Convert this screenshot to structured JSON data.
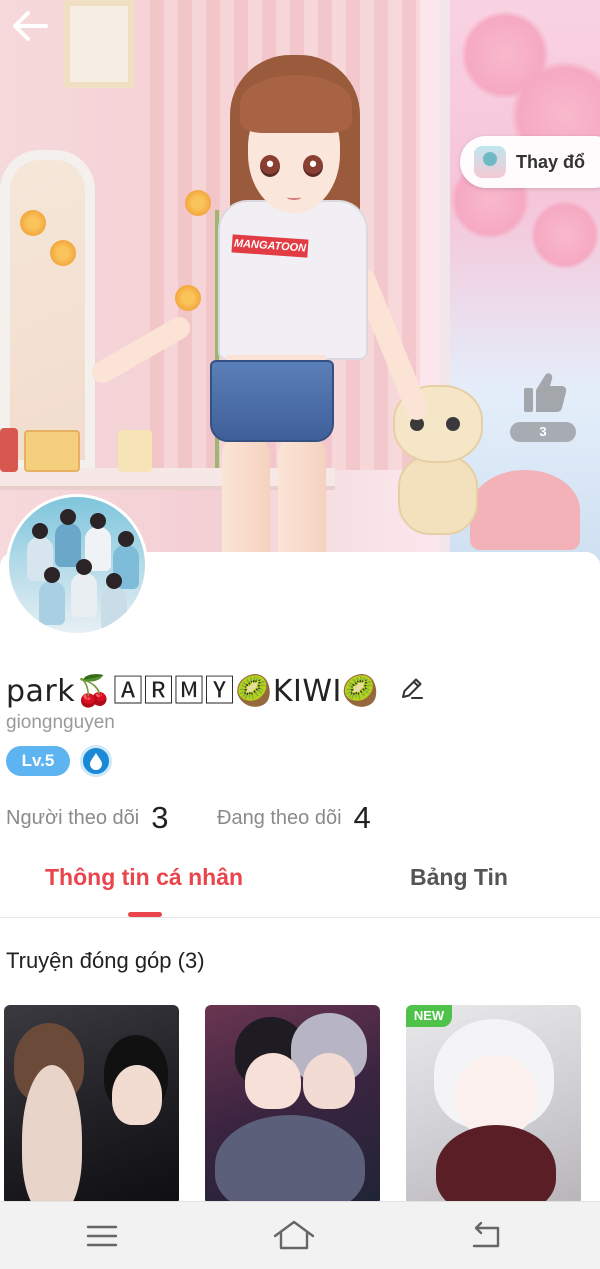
{
  "hero": {
    "shirt_logo": "MANGATOON",
    "change_outfit_label": "Thay đổ",
    "like_count": "3"
  },
  "profile": {
    "display_name": "park🍒🄰🅁🄼🅈🥝KIWI🥝",
    "username": "giongnguyen",
    "level": "Lv.5",
    "followers_label": "Người theo dõi",
    "followers_count": "3",
    "following_label": "Đang theo dõi",
    "following_count": "4"
  },
  "tabs": [
    {
      "label": "Thông tin cá nhân",
      "active": true
    },
    {
      "label": "Bảng Tin",
      "active": false
    }
  ],
  "contributions": {
    "title": "Truyện đóng góp (3)",
    "items": [
      {
        "badge": ""
      },
      {
        "badge": ""
      },
      {
        "badge": "NEW"
      }
    ]
  },
  "colors": {
    "accent": "#e9454c",
    "level_badge": "#5db4f0",
    "new_tag": "#4fc24a"
  },
  "icons": {
    "back": "arrow-left-icon",
    "edit": "pencil-icon",
    "like": "thumbs-up-icon",
    "nav": [
      "menu-icon",
      "home-icon",
      "back-icon"
    ]
  }
}
